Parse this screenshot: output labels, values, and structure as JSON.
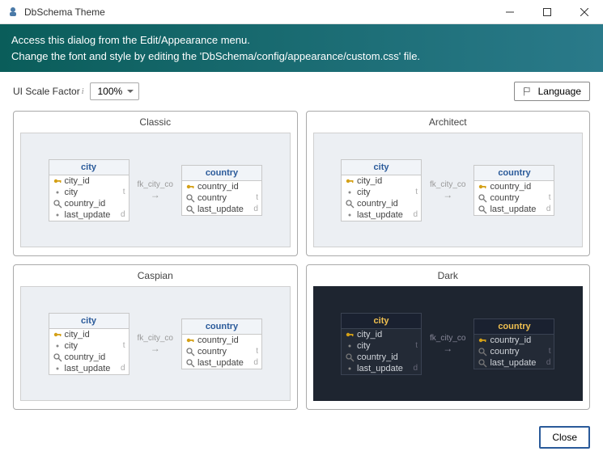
{
  "window": {
    "title": "DbSchema Theme"
  },
  "banner": {
    "line1": "Access this dialog from the Edit/Appearance menu.",
    "line2": "Change the font and style by editing the 'DbSchema/config/appearance/custom.css' file."
  },
  "scale": {
    "label": "UI Scale Factor",
    "value": "100%"
  },
  "language_btn": "Language",
  "close_btn": "Close",
  "themes": {
    "classic": "Classic",
    "architect": "Architect",
    "caspian": "Caspian",
    "dark": "Dark"
  },
  "fk": "fk_city_co",
  "city": {
    "name": "city",
    "cols": [
      {
        "n": "city_id",
        "k": "key",
        "t": ""
      },
      {
        "n": "city",
        "k": "star",
        "t": "t"
      },
      {
        "n": "country_id",
        "k": "mag",
        "t": ""
      },
      {
        "n": "last_update",
        "k": "star",
        "t": "d"
      }
    ]
  },
  "country": {
    "name": "country",
    "cols": [
      {
        "n": "country_id",
        "k": "key",
        "t": ""
      },
      {
        "n": "country",
        "k": "mag",
        "t": "t"
      },
      {
        "n": "last_update",
        "k": "mag",
        "t": "d"
      }
    ]
  }
}
